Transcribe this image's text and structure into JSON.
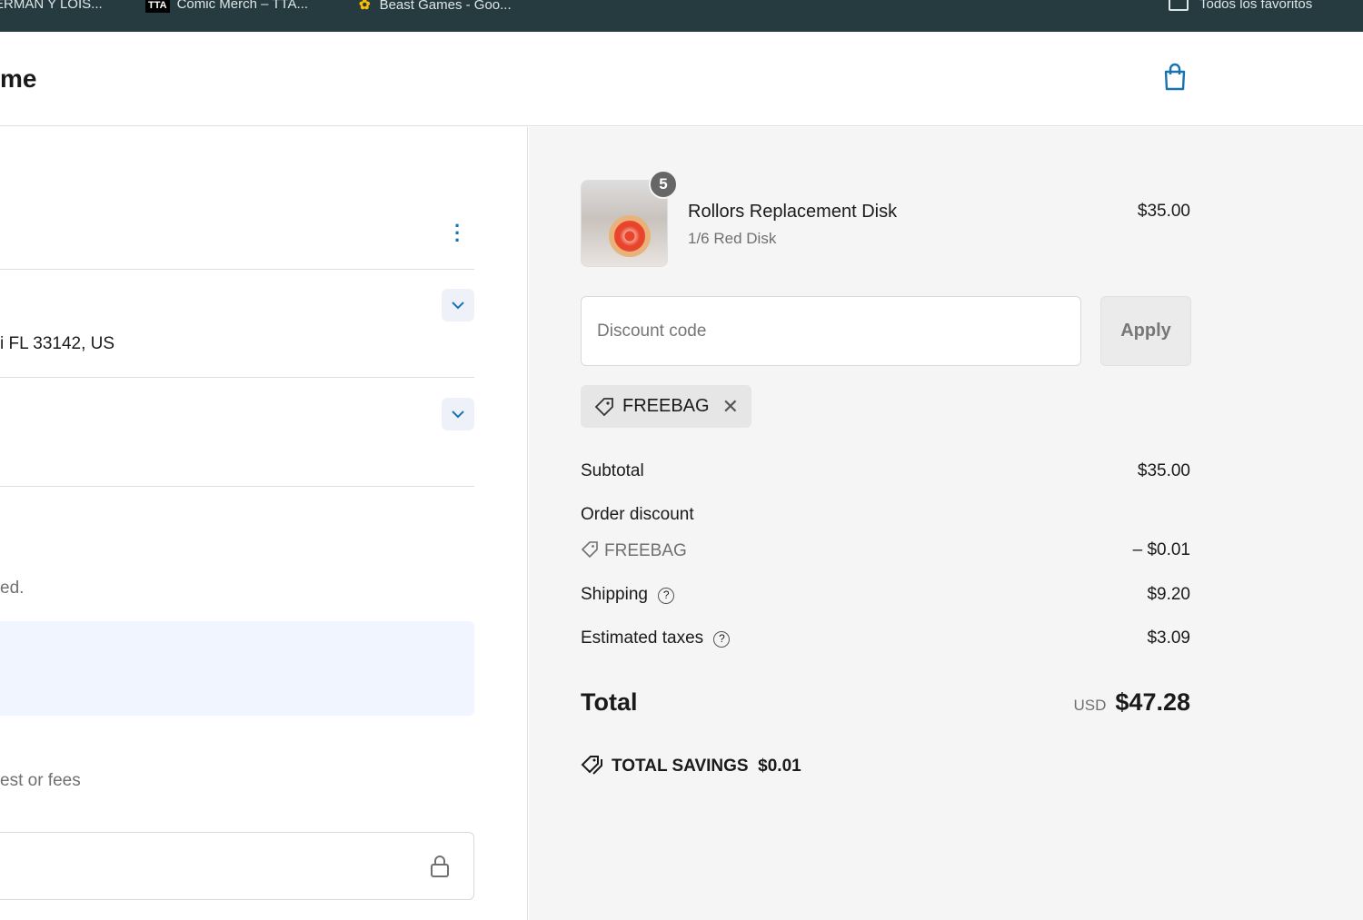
{
  "bookmarks": [
    "ERMAN Y LOIS...",
    "Comic Merch – TTA...",
    "Beast Games - Goo...",
    "Todos los favoritos"
  ],
  "header": {
    "logo": "me"
  },
  "left": {
    "address": "i FL 33142, US",
    "note": "ed.",
    "fees": "est or fees"
  },
  "cart": {
    "item": {
      "name": "Rollors Replacement Disk",
      "variant": "1/6 Red Disk",
      "price": "$35.00",
      "quantity": "5"
    }
  },
  "discount": {
    "placeholder": "Discount code",
    "apply": "Apply",
    "applied_code": "FREEBAG"
  },
  "summary": {
    "subtotal_label": "Subtotal",
    "subtotal": "$35.00",
    "order_discount_label": "Order discount",
    "discount_code": "FREEBAG",
    "discount_amount": "– $0.01",
    "shipping_label": "Shipping",
    "shipping": "$9.20",
    "taxes_label": "Estimated taxes",
    "taxes": "$3.09",
    "total_label": "Total",
    "currency": "USD",
    "total": "$47.28",
    "savings_label": "TOTAL SAVINGS",
    "savings": "$0.01"
  }
}
